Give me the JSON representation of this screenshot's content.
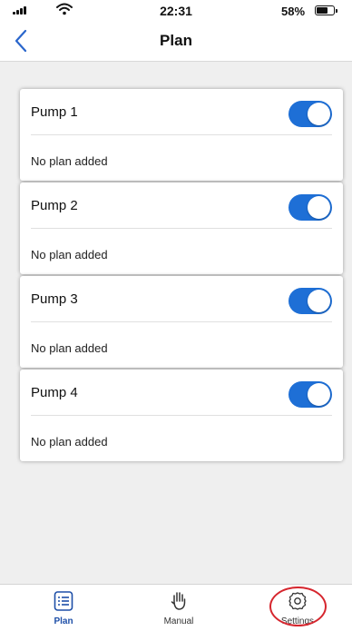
{
  "status_bar": {
    "time": "22:31",
    "battery_percent": "58%",
    "battery_level": 0.58
  },
  "nav": {
    "title": "Plan",
    "back_icon": "chevron-left-icon"
  },
  "pumps": [
    {
      "name": "Pump 1",
      "note": "No plan added",
      "enabled": true
    },
    {
      "name": "Pump 2",
      "note": "No plan added",
      "enabled": true
    },
    {
      "name": "Pump 3",
      "note": "No plan added",
      "enabled": true
    },
    {
      "name": "Pump 4",
      "note": "No plan added",
      "enabled": true
    }
  ],
  "tabs": [
    {
      "label": "Plan",
      "icon": "list-icon",
      "active": true
    },
    {
      "label": "Manual",
      "icon": "hand-icon",
      "active": false
    },
    {
      "label": "Settings",
      "icon": "gear-icon",
      "active": false
    }
  ],
  "colors": {
    "accent": "#1e6fd6",
    "active_tab": "#1e4fa8",
    "highlight": "#d6262e",
    "background": "#efefef"
  }
}
